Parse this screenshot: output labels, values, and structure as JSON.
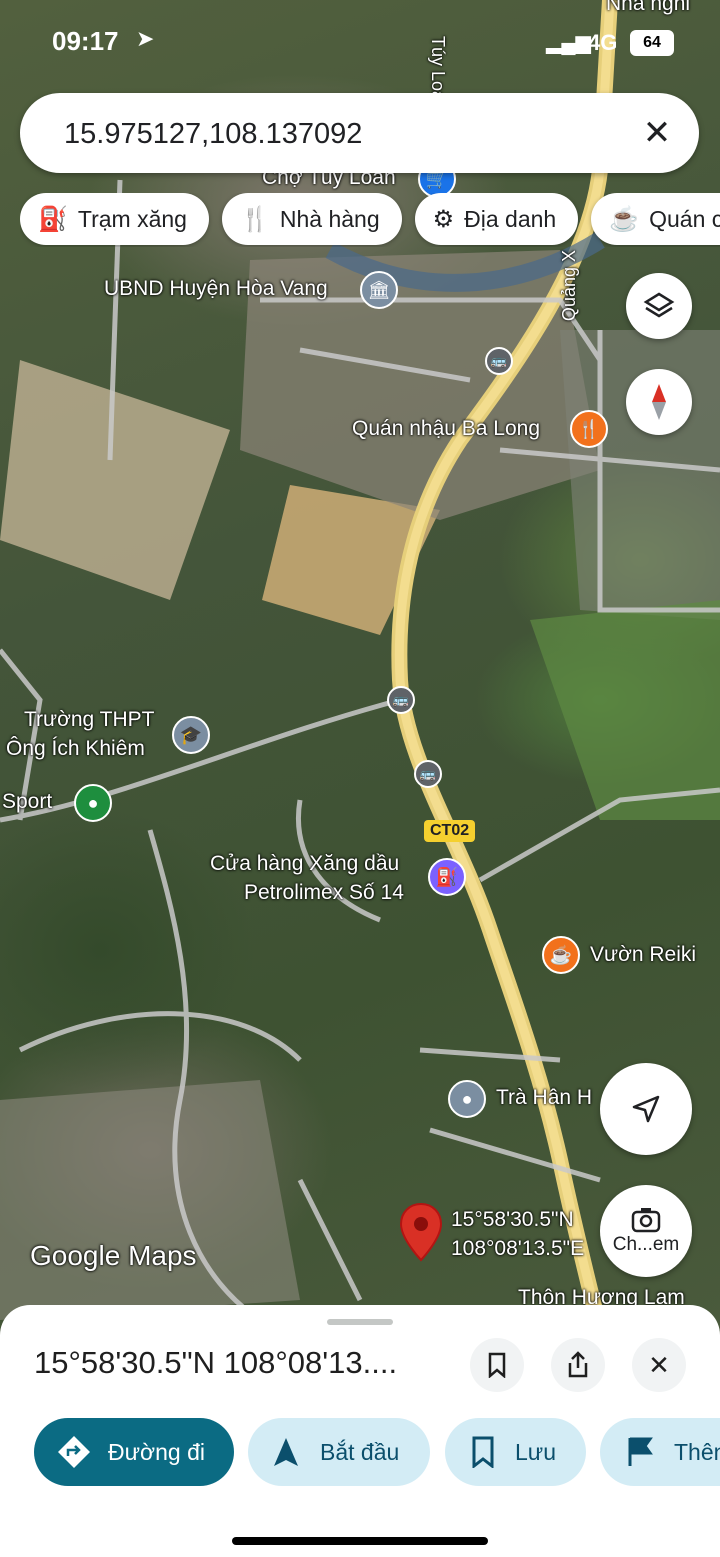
{
  "status_bar": {
    "time": "09:17",
    "network": "4G",
    "battery": "64"
  },
  "search": {
    "value": "15.975127,108.137092"
  },
  "chips": [
    {
      "icon": "gas-station-icon",
      "label": "Trạm xăng"
    },
    {
      "icon": "restaurant-icon",
      "label": "Nhà hàng"
    },
    {
      "icon": "landmark-icon",
      "label": "Địa danh"
    },
    {
      "icon": "coffee-icon",
      "label": "Quán c"
    }
  ],
  "map": {
    "labels": {
      "top_right": "Nhà nghỉ",
      "tuy_loan_road": "Túy Loan",
      "cho_tuy_loan": "Chợ Túy Loan",
      "ubnd": "UBND Huyện Hòa Vang",
      "quang_road": "Quảng X",
      "quan_nhau": "Quán nhậu Ba Long",
      "truong_line1": "Trường THPT",
      "truong_line2": "Ông Ích Khiêm",
      "sport": "Sport",
      "ct02": "CT02",
      "petrol_line1": "Cửa hàng Xăng dầu",
      "petrol_line2": "Petrolimex Số 14",
      "vuon_reiki": "Vườn Reiki",
      "tra_han": "Trà Hân H",
      "pin_lat": "15°58'30.5\"N",
      "pin_lng": "108°08'13.5\"E",
      "thon": "Thôn Hương Lam",
      "camera_label": "Ch...em",
      "google_maps": "Google Maps"
    },
    "accent_colors": {
      "pin": "#d93025",
      "gas": "#7b61ff",
      "food": "#f2711c",
      "school": "#7b8ea1",
      "green": "#1e8e3e"
    }
  },
  "sheet": {
    "coordinates": "15°58'30.5\"N 108°08'13....",
    "actions": [
      {
        "icon": "directions-icon",
        "label": "Đường đi",
        "primary": true
      },
      {
        "icon": "navigation-icon",
        "label": "Bắt đầu"
      },
      {
        "icon": "bookmark-icon",
        "label": "Lưu"
      },
      {
        "icon": "flag-icon",
        "label": "Thên"
      }
    ]
  }
}
